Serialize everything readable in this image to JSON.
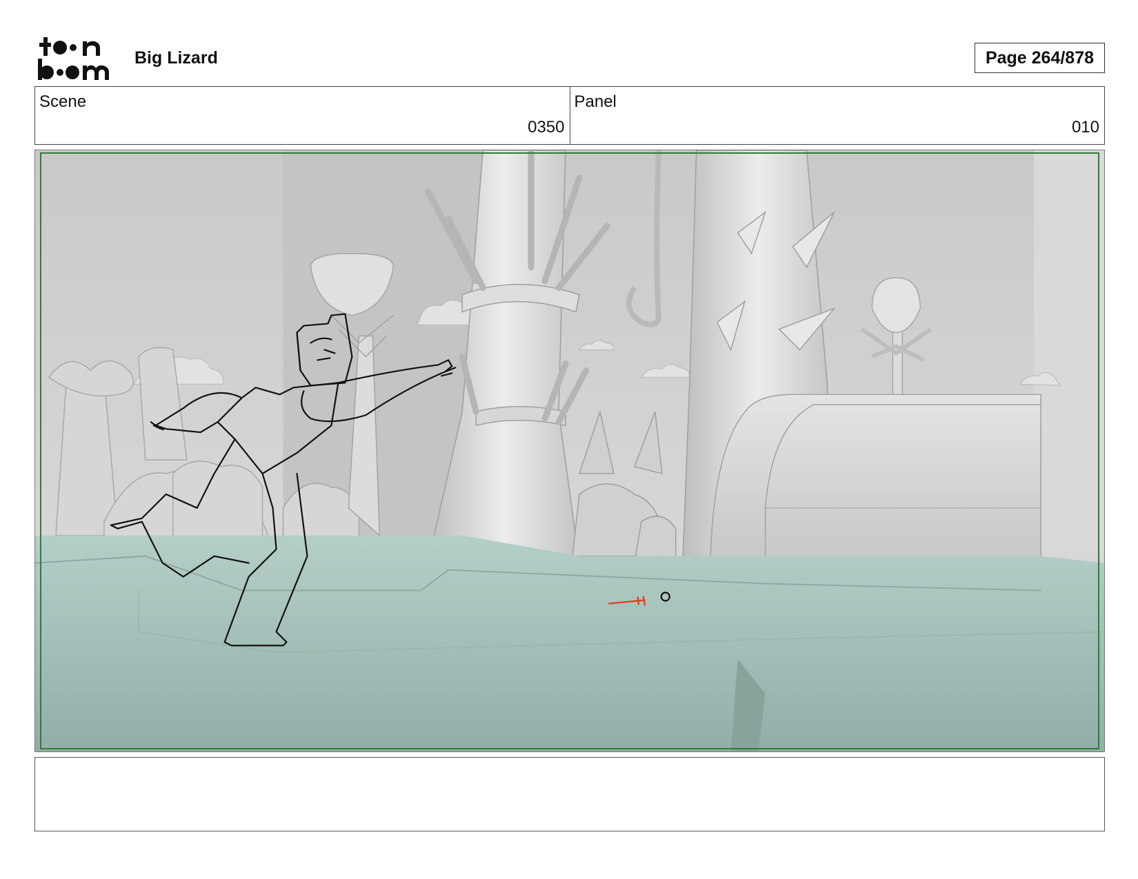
{
  "header": {
    "logo_text": "toon boom",
    "project_title": "Big Lizard",
    "page_label": "Page 264/878"
  },
  "info": {
    "scene_label": "Scene",
    "scene_value": "0350",
    "panel_label": "Panel",
    "panel_value": "010"
  },
  "panel": {
    "frame_color": "#2e7d32",
    "sketch_color": "#111111",
    "annotation_color": "#e53a1e",
    "ground_color": "#a4c4bc",
    "background_color": "#d2d2d2"
  },
  "notes": {
    "text": ""
  }
}
